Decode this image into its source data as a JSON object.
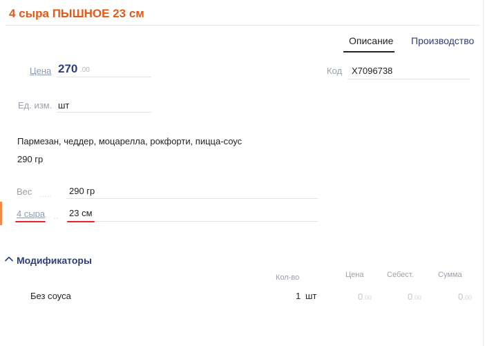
{
  "product": {
    "title": "4 сыра ПЫШНОЕ 23 см"
  },
  "tabs": [
    {
      "label": "Описание",
      "active": true
    },
    {
      "label": "Производство",
      "active": false
    }
  ],
  "fields": {
    "price_label": "Цена",
    "price_int": "270",
    "price_dec": ".00",
    "code_label": "Код",
    "code_value": "X7096738",
    "unit_label": "Ед. изм.",
    "unit_value": "шт"
  },
  "description": {
    "ingredients": "Пармезан, чеддер, моцарелла, рокфорти, пицца-соус",
    "weight": "290 гр"
  },
  "properties": [
    {
      "label": "Вес",
      "dots": ".....",
      "value": "290 гр"
    },
    {
      "label": "4 сыра",
      "dots": "..",
      "value": "23 см"
    }
  ],
  "modifiers": {
    "title": "Модификаторы",
    "columns": {
      "qty": "Кол-во",
      "price": "Цена",
      "cost": "Себест.",
      "sum": "Сумма"
    },
    "rows": [
      {
        "name": "Без соуса",
        "qty": "1",
        "unit": "шт",
        "price_int": "0",
        "price_dec": ".00",
        "cost_int": "0",
        "cost_dec": ".00",
        "sum_int": "0",
        "sum_dec": ".00"
      }
    ]
  },
  "colors": {
    "title": "#e05a1a",
    "accent_blue": "#2c3e7a",
    "active_bar": "#f08a4b",
    "annotation_red": "#e8202a"
  },
  "icons": {
    "modifiers_toggle": "chevron-up-icon"
  }
}
